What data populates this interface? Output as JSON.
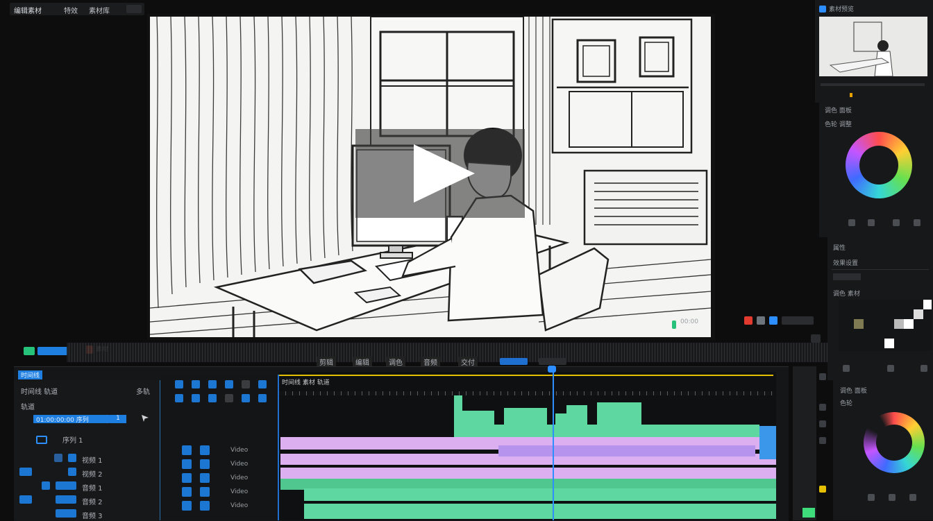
{
  "topbar": {
    "tabs": [
      {
        "label": "编辑素材"
      },
      {
        "label": "特效"
      },
      {
        "label": "素材库"
      }
    ]
  },
  "viewer": {
    "play_icon": "play-icon"
  },
  "viewer_controls": {
    "left_badge": "00:00",
    "left_badge2": "素材"
  },
  "toolbar_row": {
    "items": [
      "剪辑",
      "编辑",
      "调色",
      "音频",
      "交付"
    ]
  },
  "timeline_panel": {
    "title": "时间线",
    "sequence_label": "序列 1",
    "track_header_title": "时间线 轨道",
    "track_header_meta": "轨道",
    "track_header_right": "多轨",
    "sequence_selector": "01:00:00:00 序列",
    "sequence_value": "1",
    "ruler_label": "时间线 素材 轨道",
    "track_labels": [
      "视频 1",
      "视频 2",
      "音频 1",
      "音频 2",
      "音频 3"
    ],
    "ctrl_labels": [
      "Video",
      "Video",
      "Video",
      "Video",
      "Video"
    ]
  },
  "right_panels": {
    "preview_title": "素材预览",
    "color_title": "调色 面板",
    "color_subtitle": "色轮 调整",
    "props_title": "属性",
    "props_subtitle": "效果设置",
    "props_section": "调色 素材",
    "wheel2_title": "调色 面板",
    "wheel2_subtitle": "色轮"
  },
  "colors": {
    "accent": "#2d8fff",
    "clip_green": "#5fd7a0",
    "clip_pink": "#dcb0f0",
    "clip_violet": "#b694ee",
    "ruler": "#e4c000"
  }
}
